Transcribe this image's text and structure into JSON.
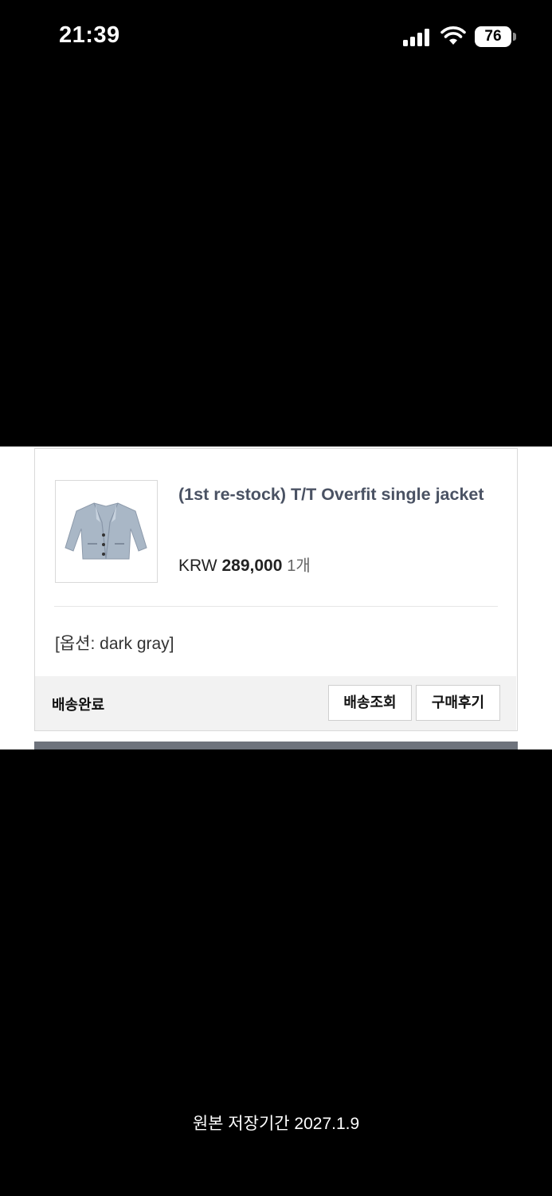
{
  "status_bar": {
    "time": "21:39",
    "battery": "76",
    "icons": [
      "signal-icon",
      "wifi-icon",
      "battery-icon"
    ]
  },
  "order": {
    "product_name": "(1st re-stock) T/T Overfit single jacket",
    "currency": "KRW",
    "price": "289,000",
    "quantity": "1개",
    "option": "[옵션: dark gray]",
    "delivery_status": "배송완료",
    "buttons": {
      "track": "배송조회",
      "review": "구매후기"
    },
    "thumbnail_icon": "jacket-thumbnail"
  },
  "caption": "원본 저장기간 2027.1.9",
  "colors": {
    "background": "#000000",
    "card_title": "#4a5263",
    "footer_bg": "#f2f2f2",
    "next_card_edge": "#6e737c"
  }
}
